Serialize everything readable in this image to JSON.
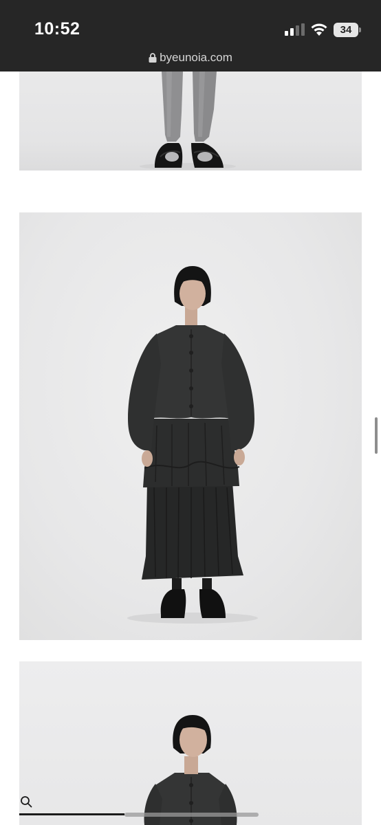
{
  "status_bar": {
    "time": "10:52",
    "battery_level": "34",
    "signal_bars_active": 2,
    "signal_bars_total": 4
  },
  "browser": {
    "url": "byeunoia.com"
  },
  "gallery": {
    "images": [
      {
        "name": "product-photo-legs-shoes"
      },
      {
        "name": "product-photo-full-outfit"
      },
      {
        "name": "product-photo-upper-body"
      }
    ],
    "progress": 0.44
  },
  "colors": {
    "status_bar_bg": "#262626",
    "page_bg": "#ffffff",
    "photo_bg": "#e8e8e9",
    "garment": "#2f3030"
  },
  "icons": [
    "lock-icon",
    "signal-icon",
    "wifi-icon",
    "battery-icon",
    "search-icon"
  ]
}
